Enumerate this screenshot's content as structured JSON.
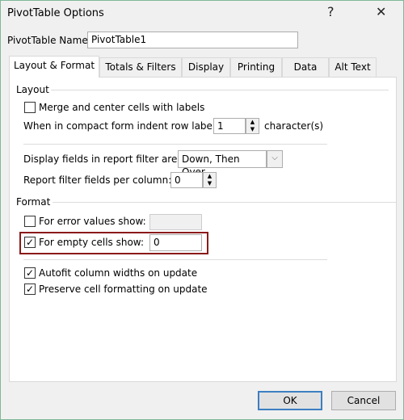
{
  "window": {
    "title": "PivotTable Options",
    "help_label": "?",
    "close_label": "✕"
  },
  "name_field": {
    "label": "PivotTable Name:",
    "value": "PivotTable1"
  },
  "tabs": [
    {
      "label": "Layout & Format",
      "selected": true
    },
    {
      "label": "Totals & Filters"
    },
    {
      "label": "Display"
    },
    {
      "label": "Printing"
    },
    {
      "label": "Data"
    },
    {
      "label": "Alt Text"
    }
  ],
  "layout": {
    "heading": "Layout",
    "merge": {
      "label": "Merge and center cells with labels",
      "checked": false
    },
    "indent": {
      "label": "When in compact form indent row labels:",
      "value": "1",
      "suffix": "character(s)"
    },
    "filter_area": {
      "label": "Display fields in report filter area:",
      "value": "Down, Then Over"
    },
    "filter_per_column": {
      "label": "Report filter fields per column:",
      "value": "0"
    }
  },
  "format": {
    "heading": "Format",
    "error_values": {
      "label": "For error values show:",
      "checked": false,
      "value": ""
    },
    "empty_cells": {
      "label": "For empty cells show:",
      "checked": true,
      "value": "0"
    },
    "highlight_color": "#8b1a1a",
    "autofit": {
      "label": "Autofit column widths on update",
      "checked": true
    },
    "preserve": {
      "label": "Preserve cell formatting on update",
      "checked": true
    }
  },
  "buttons": {
    "ok": "OK",
    "cancel": "Cancel"
  }
}
